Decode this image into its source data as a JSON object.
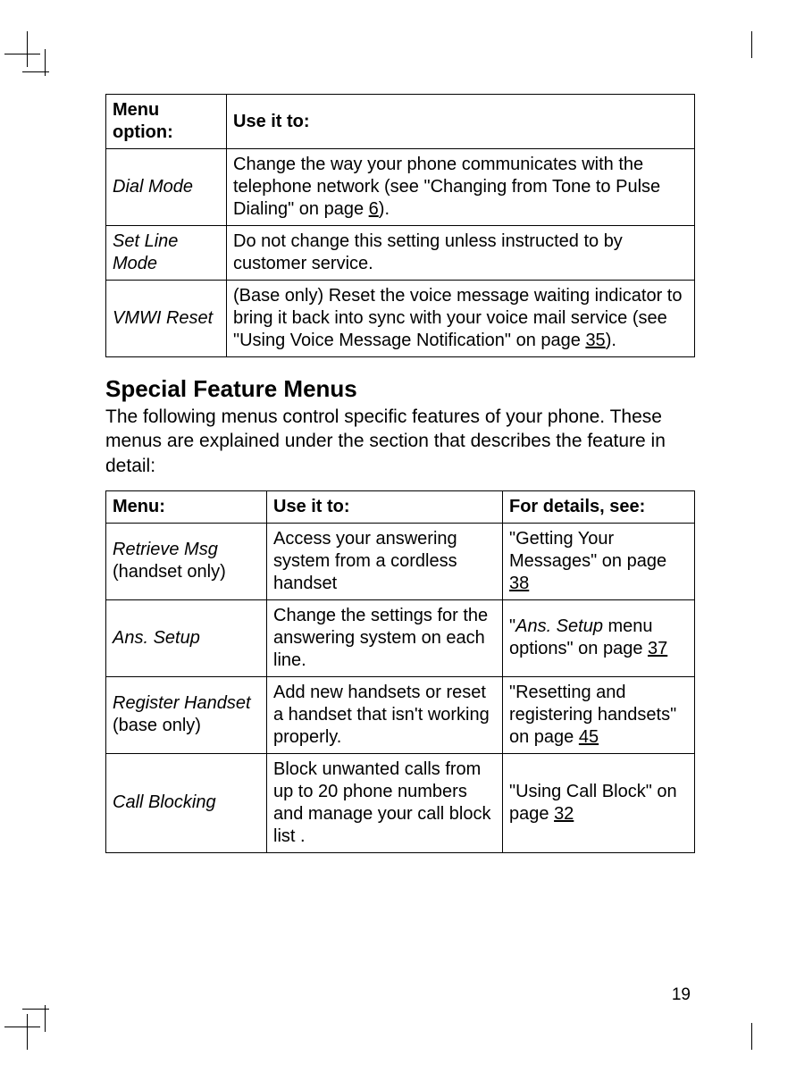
{
  "table1": {
    "headers": [
      "Menu option:",
      "Use it to:"
    ],
    "rows": [
      {
        "option": "Dial Mode",
        "desc_pre": "Change the way your phone communicates with the telephone network (see \"Changing from Tone to Pulse Dialing\" on page ",
        "page": "6",
        "desc_post": ")."
      },
      {
        "option": "Set Line Mode",
        "desc": "Do not change this setting unless instructed to by customer service."
      },
      {
        "option": "VMWI Reset",
        "desc_pre": "(Base only) Reset the voice message waiting indicator to bring it back into sync with your voice mail service (see \"Using Voice Message Notification\" on page ",
        "page": "35",
        "desc_post": ")."
      }
    ]
  },
  "heading": "Special Feature Menus",
  "intro": "The following menus control specific features of your phone. These menus are explained under the section that describes the feature in detail:",
  "table2": {
    "headers": [
      "Menu:",
      "Use it to:",
      "For details, see:"
    ],
    "rows": [
      {
        "menu_em": "Retrieve Msg",
        "menu_note": " (handset only)",
        "use": "Access your answering system from a cordless handset",
        "see_pre": "\"Getting Your Messages\" on page ",
        "see_page": "38",
        "see_post": ""
      },
      {
        "menu_em": "Ans. Setup",
        "menu_note": "",
        "use": "Change the settings for the answering system on each line.",
        "see_pre_q": "\"",
        "see_em": "Ans. Setup",
        "see_mid": " menu options\" on page ",
        "see_page": "37",
        "see_post": ""
      },
      {
        "menu_em": "Register Handset",
        "menu_note": " (base only)",
        "use": "Add new handsets or reset a handset that isn't working properly.",
        "see_pre": "\"Resetting and registering handsets\" on page ",
        "see_page": "45",
        "see_post": ""
      },
      {
        "menu_em": "Call Blocking",
        "menu_note": "",
        "use": "Block unwanted calls from up to 20 phone numbers and manage your call block list .",
        "see_pre": "\"Using Call Block\" on page ",
        "see_page": "32",
        "see_post": ""
      }
    ]
  },
  "page_number": "19"
}
